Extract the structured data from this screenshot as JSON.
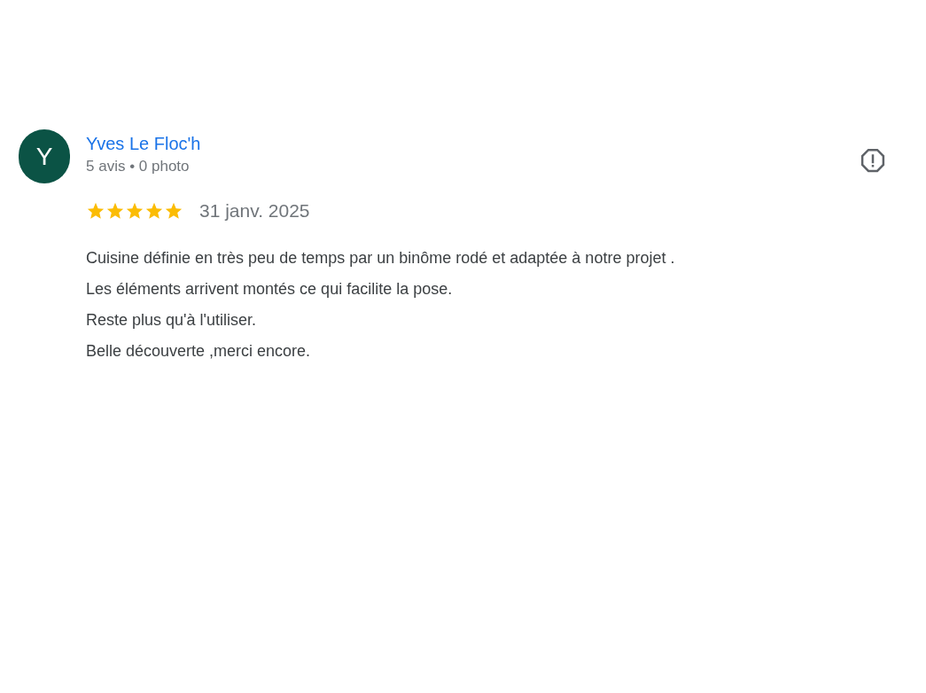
{
  "review": {
    "avatar_letter": "Y",
    "author": "Yves Le Floc'h",
    "author_meta": "5 avis • 0 photo",
    "stars": 5,
    "date": "31 janv. 2025",
    "text_lines": [
      "Cuisine définie en très peu de temps par un binôme rodé et adaptée à notre projet .",
      "Les éléments arrivent montés ce qui facilite la pose.",
      "Reste plus qu'à l'utiliser.",
      "Belle découverte ,merci encore."
    ]
  }
}
